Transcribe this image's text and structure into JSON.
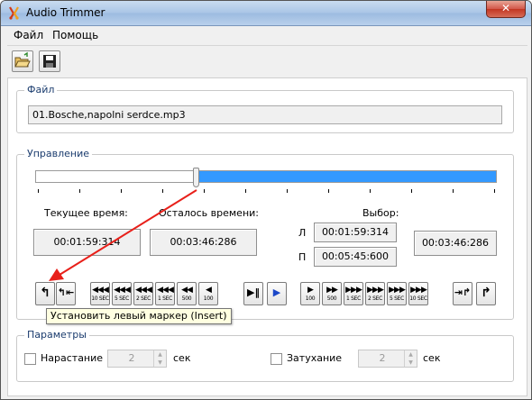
{
  "window": {
    "title": "Audio Trimmer",
    "close_glyph": "✕"
  },
  "menu": {
    "items": [
      "Файл",
      "Помощь"
    ]
  },
  "toolbar": {
    "buttons": [
      {
        "icon": "open-folder-icon"
      },
      {
        "icon": "save-disk-icon"
      }
    ]
  },
  "file_group": {
    "legend": "Файл",
    "filename": "01.Bosche,napolni serdce.mp3"
  },
  "control_group": {
    "legend": "Управление",
    "position_fraction": 0.35,
    "current_label": "Текущее время:",
    "current_value": "00:01:59:314",
    "remaining_label": "Осталось времени:",
    "remaining_value": "00:03:46:286",
    "selection_label": "Выбор:",
    "left_marker_label": "Л",
    "left_value": "00:01:59:314",
    "right_marker_label": "П",
    "right_value": "00:05:45:600",
    "selection_value": "00:03:46:286",
    "accent_color": "#3399ff"
  },
  "buttons": {
    "set_left": {
      "glyph": "↰"
    },
    "goto_left": {
      "glyph": "↰⇤"
    },
    "rew10": {
      "glyph": "◀◀◀",
      "sub": "10 SEC"
    },
    "rew5": {
      "glyph": "◀◀◀",
      "sub": "5 SEC"
    },
    "rew2": {
      "glyph": "◀◀◀",
      "sub": "2 SEC"
    },
    "rew1": {
      "glyph": "◀◀◀",
      "sub": "1 SEC"
    },
    "rew500": {
      "glyph": "◀◀",
      "sub": "500"
    },
    "rew100": {
      "glyph": "◀",
      "sub": "100"
    },
    "play_pause": {
      "glyph": "▶‖"
    },
    "play_stop": {
      "glyph": "▶"
    },
    "fwd100": {
      "glyph": "▶",
      "sub": "100"
    },
    "fwd500": {
      "glyph": "▶▶",
      "sub": "500"
    },
    "fwd1": {
      "glyph": "▶▶▶",
      "sub": "1 SEC"
    },
    "fwd2": {
      "glyph": "▶▶▶",
      "sub": "2 SEC"
    },
    "fwd5": {
      "glyph": "▶▶▶",
      "sub": "5 SEC"
    },
    "fwd10": {
      "glyph": "▶▶▶",
      "sub": "10 SEC"
    },
    "goto_right": {
      "glyph": "⇥↱"
    },
    "set_right": {
      "glyph": "↱"
    }
  },
  "tooltip": {
    "text": "Установить левый маркер (Insert)"
  },
  "params_group": {
    "legend": "Параметры",
    "fade_in_label": "Нарастание",
    "fade_in_value": "2",
    "fade_in_unit": "сек",
    "fade_out_label": "Затухание",
    "fade_out_value": "2",
    "fade_out_unit": "сек"
  }
}
